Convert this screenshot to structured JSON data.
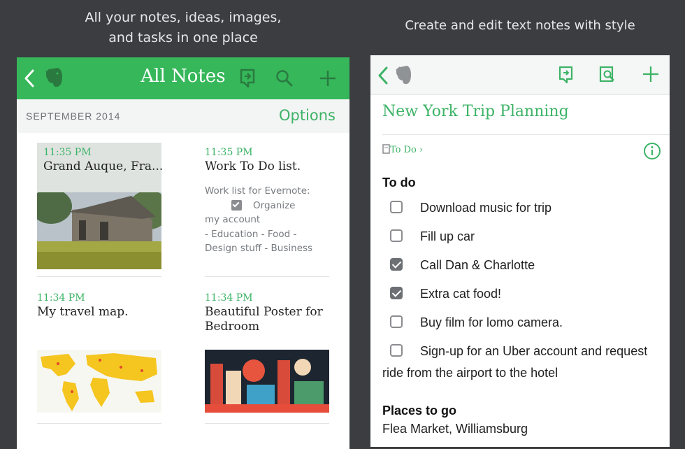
{
  "captions": {
    "left_line1": "All your notes, ideas, images,",
    "left_line2": "and tasks in one place",
    "right": "Create and edit text notes with style"
  },
  "left_screen": {
    "header": {
      "title": "All Notes"
    },
    "section": {
      "month": "SEPTEMBER 2014",
      "options": "Options"
    },
    "notes": [
      {
        "time": "11:35 PM",
        "title": "Grand Auque, Fra..."
      },
      {
        "time": "11:35 PM",
        "title": "Work To Do list.",
        "body_line1": "Work list for Evernote:",
        "checklist_item": "Organize",
        "body_line2": "my account",
        "body_line3": "- Education - Food -",
        "body_line4": "Design stuff - Business"
      },
      {
        "time": "11:34 PM",
        "title": "My travel map."
      },
      {
        "time": "11:34 PM",
        "title_line1": "Beautiful  Poster for",
        "title_line2": "Bedroom"
      }
    ]
  },
  "right_screen": {
    "note_title": "New York Trip Planning",
    "tag": "To Do",
    "todo_heading": "To do",
    "todos": [
      {
        "label": "Download music for trip",
        "checked": false
      },
      {
        "label": "Fill up car",
        "checked": false
      },
      {
        "label": "Call Dan & Charlotte",
        "checked": true
      },
      {
        "label": "Extra cat food!",
        "checked": true
      },
      {
        "label": "Buy film for lomo camera.",
        "checked": false
      },
      {
        "label": "Sign-up for an Uber account and request",
        "label_cont": "ride from the airport to the hotel",
        "checked": false
      }
    ],
    "places_heading": "Places to go",
    "places": [
      "Flea Market, Williamsburg"
    ]
  },
  "colors": {
    "accent": "#36b75a",
    "background": "#3b3d41"
  },
  "icons": [
    "back-icon",
    "evernote-elephant-icon",
    "sync-icon",
    "search-icon",
    "add-icon",
    "note-info-icon",
    "info-icon"
  ]
}
